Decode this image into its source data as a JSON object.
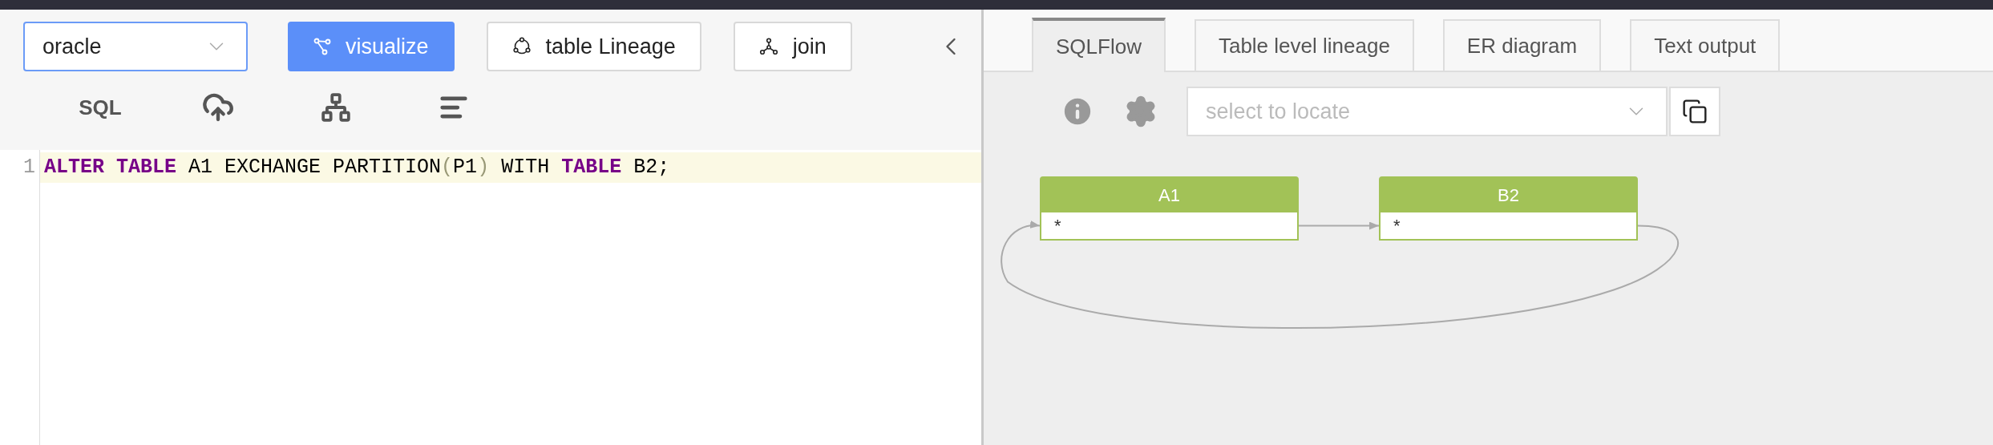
{
  "left_panel": {
    "dialect_select": {
      "value": "oracle"
    },
    "buttons": [
      {
        "label": "visualize",
        "kind": "primary"
      },
      {
        "label": "table Lineage",
        "kind": "default"
      },
      {
        "label": "join",
        "kind": "default"
      }
    ],
    "tools": [
      {
        "kind": "text",
        "label": "SQL"
      },
      {
        "kind": "upload"
      },
      {
        "kind": "tree"
      },
      {
        "kind": "format"
      }
    ],
    "editor": {
      "lines": [
        {
          "number": "1",
          "highlighted": true,
          "tokens": [
            {
              "text": "ALTER",
              "kind": "keyword"
            },
            {
              "text": " TABLE",
              "kind": "keyword"
            },
            {
              "text": " A1 EXCHANGE PARTITION",
              "kind": "plain"
            },
            {
              "text": "(",
              "kind": "bracket"
            },
            {
              "text": "P1",
              "kind": "plain"
            },
            {
              "text": ")",
              "kind": "bracket"
            },
            {
              "text": " WITH ",
              "kind": "plain"
            },
            {
              "text": "TABLE",
              "kind": "keyword"
            },
            {
              "text": " B2;",
              "kind": "plain"
            }
          ]
        }
      ]
    }
  },
  "right_panel": {
    "tabs": [
      {
        "label": "SQLFlow",
        "selected": true
      },
      {
        "label": "Table level lineage",
        "selected": false
      },
      {
        "label": "ER diagram",
        "selected": false
      },
      {
        "label": "Text output",
        "selected": false
      }
    ],
    "locate_select": {
      "placeholder": "select to locate"
    },
    "diagram": {
      "nodes": [
        {
          "title": "A1",
          "columns": [
            "*"
          ]
        },
        {
          "title": "B2",
          "columns": [
            "*"
          ]
        }
      ],
      "edges": [
        {
          "kind": "straight"
        },
        {
          "kind": "loop"
        }
      ]
    }
  }
}
